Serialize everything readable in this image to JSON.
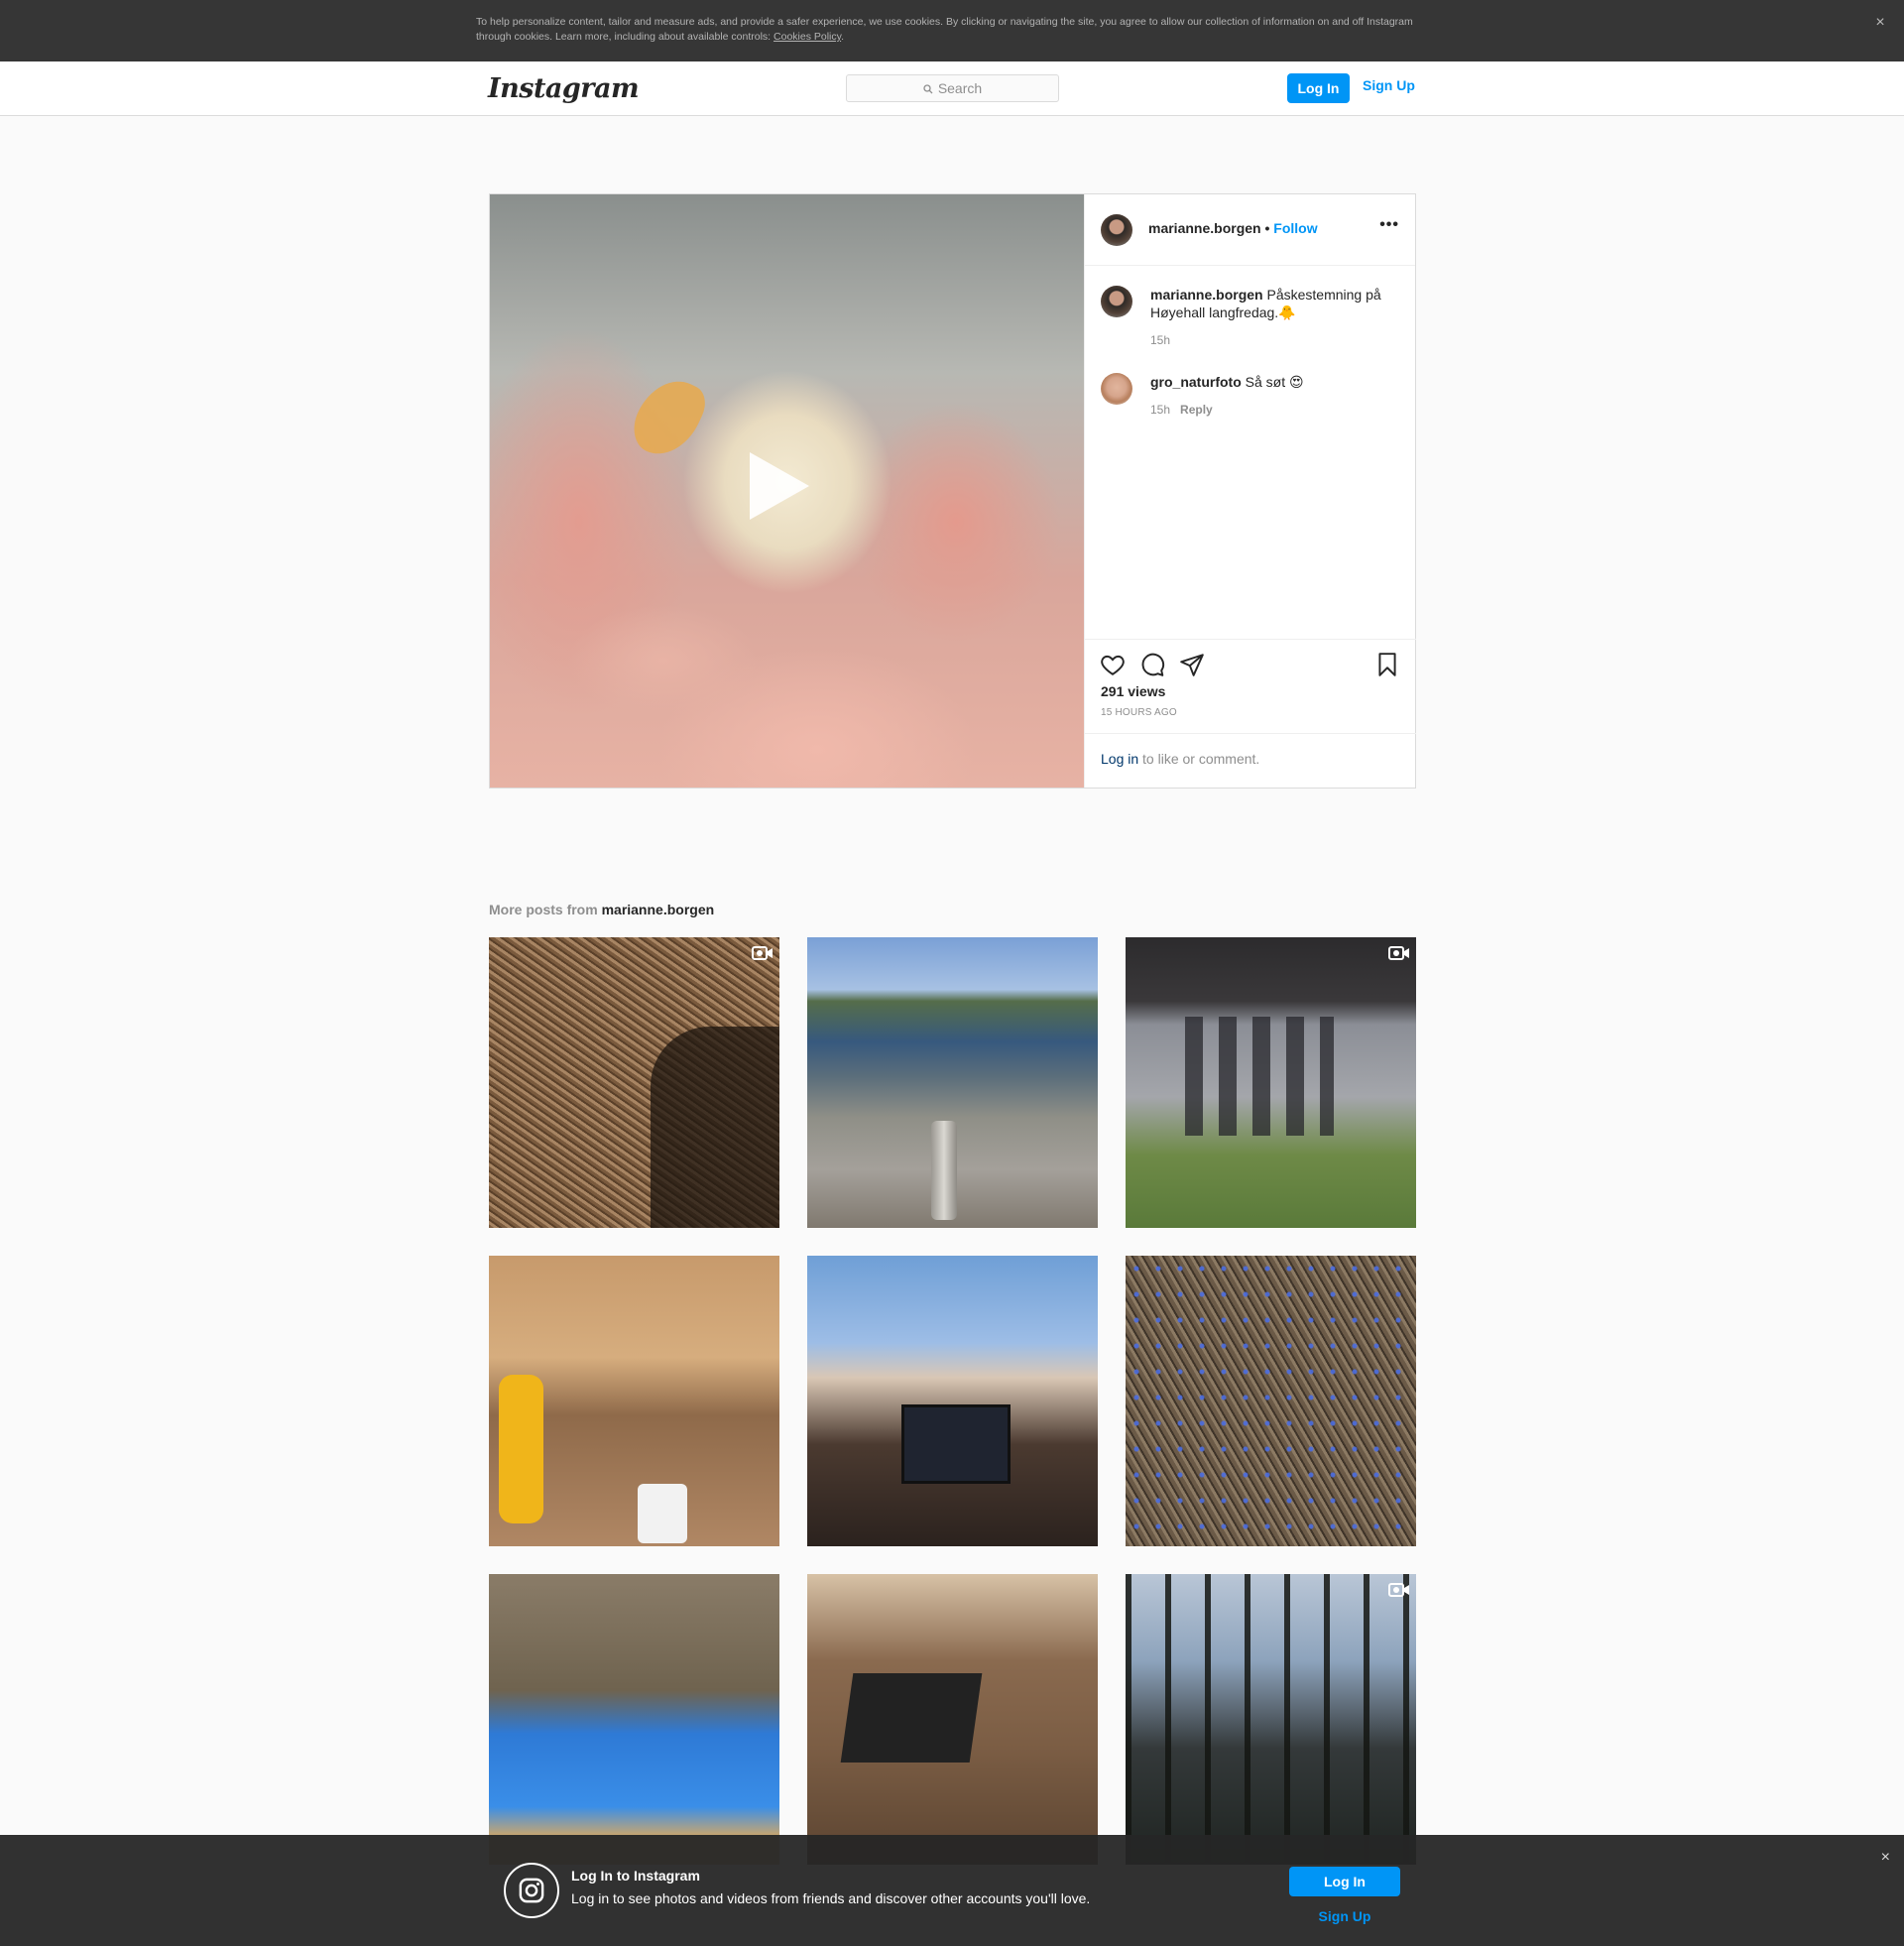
{
  "cookie_banner": {
    "text": "To help personalize content, tailor and measure ads, and provide a safer experience, we use cookies. By clicking or navigating the site, you agree to allow our collection of information on and off Instagram through cookies. Learn more, including about available controls: ",
    "link": "Cookies Policy",
    "end": ".",
    "close": "×"
  },
  "nav": {
    "logo": "Instagram",
    "search_placeholder": "Search",
    "login": "Log In",
    "signup": "Sign Up"
  },
  "post": {
    "username": "marianne.borgen",
    "dot": " • ",
    "follow": "Follow",
    "more": "•••",
    "comments": [
      {
        "user": "marianne.borgen",
        "text": " Påskestemning på Høyehall langfredag.🐥",
        "time": "15h",
        "reply": ""
      },
      {
        "user": "gro_naturfoto",
        "text": " Så søt 😍",
        "time": "15h",
        "reply": "Reply"
      }
    ],
    "views": "291 views",
    "ago": "15 HOURS AGO",
    "login_link": "Log in",
    "login_rest": " to like or comment."
  },
  "more_posts": {
    "label": "More posts from ",
    "username": "marianne.borgen"
  },
  "bottom_bar": {
    "title": "Log In to Instagram",
    "subtitle": "Log in to see photos and videos from friends and discover other accounts you'll love.",
    "login": "Log In",
    "signup": "Sign Up",
    "close": "×"
  },
  "colors": {
    "accent": "#0095f6",
    "dark_link": "#00376b",
    "muted": "#8e8e8e"
  }
}
